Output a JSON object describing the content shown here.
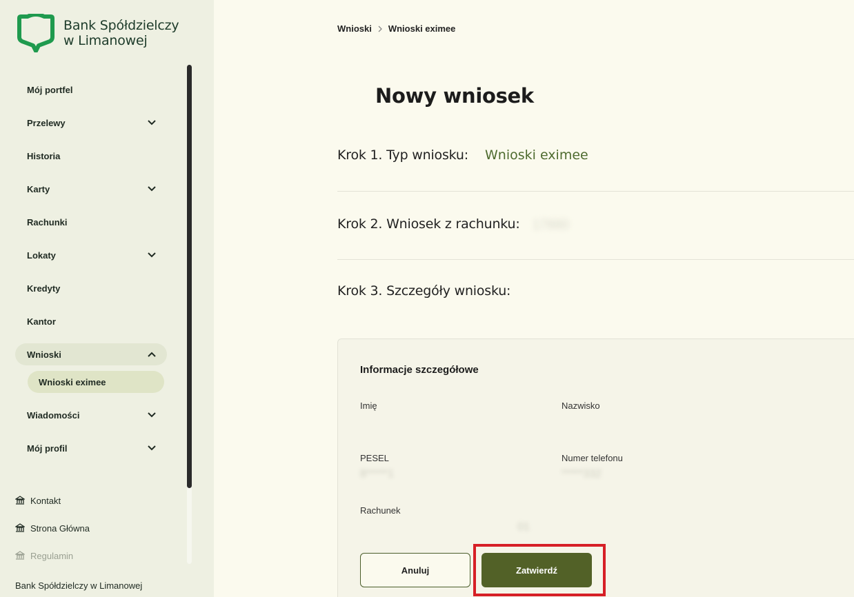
{
  "brand": {
    "line1": "Bank Spółdzielczy",
    "line2": "w Limanowej",
    "color": "#1f9a4e"
  },
  "nav": [
    {
      "label": "Mój portfel",
      "chevron": false
    },
    {
      "label": "Przelewy",
      "chevron": "down"
    },
    {
      "label": "Historia",
      "chevron": false
    },
    {
      "label": "Karty",
      "chevron": "down"
    },
    {
      "label": "Rachunki",
      "chevron": false
    },
    {
      "label": "Lokaty",
      "chevron": "down"
    },
    {
      "label": "Kredyty",
      "chevron": false
    },
    {
      "label": "Kantor",
      "chevron": false
    },
    {
      "label": "Wnioski",
      "chevron": "up"
    },
    {
      "label": "Wiadomości",
      "chevron": "down"
    },
    {
      "label": "Mój profil",
      "chevron": "down"
    }
  ],
  "nav_sub": {
    "label": "Wnioski eximee"
  },
  "links": [
    {
      "label": "Kontakt",
      "icon": "bank-icon"
    },
    {
      "label": "Strona Główna",
      "icon": "bank-icon"
    },
    {
      "label": "Regulamin",
      "icon": "bank-icon"
    }
  ],
  "footer": "Bank Spółdzielczy w Limanowej",
  "breadcrumb": [
    "Wnioski",
    "Wnioski eximee"
  ],
  "page_title": "Nowy wniosek",
  "steps": {
    "step1_label": "Krok 1. Typ wniosku:",
    "step1_value": "Wnioski eximee",
    "step2_label": "Krok 2. Wniosek z rachunku:",
    "step2_value": "17880",
    "step3_label": "Krok 3. Szczegóły wniosku:"
  },
  "details": {
    "title": "Informacje szczegółowe",
    "fields": {
      "imie_label": "Imię",
      "nazwisko_label": "Nazwisko",
      "pesel_label": "PESEL",
      "pesel_value": "8*****1",
      "telefon_label": "Numer telefonu",
      "telefon_value": "*****332",
      "rachunek_label": "Rachunek",
      "rachunek_value": "01"
    }
  },
  "buttons": {
    "cancel": "Anuluj",
    "confirm": "Zatwierdź"
  },
  "colors": {
    "accent": "#526127",
    "step_value": "#4e6b2f",
    "highlight": "#d61f26"
  }
}
